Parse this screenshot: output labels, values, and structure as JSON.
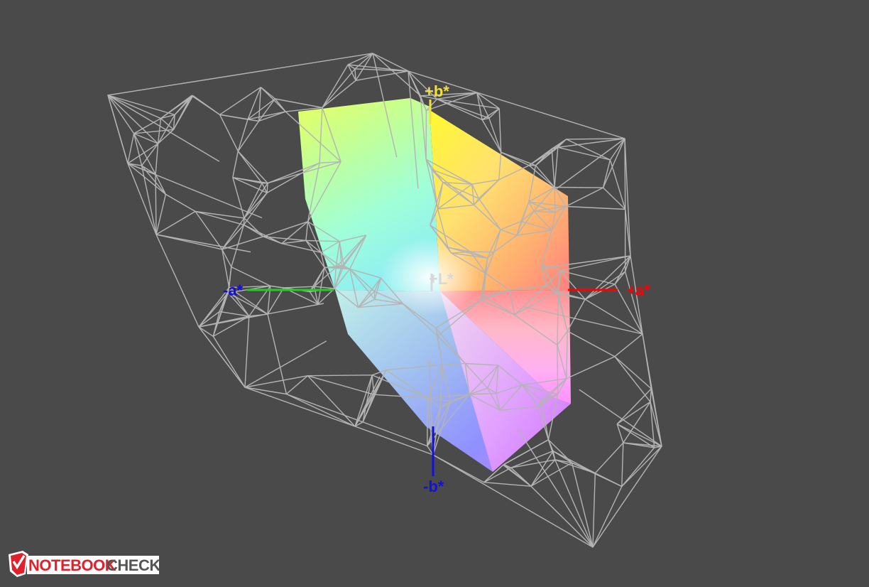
{
  "axes": {
    "plus_b": "+b*",
    "minus_a": "-a*",
    "plus_l": "+L*",
    "plus_a": "+a*",
    "minus_b": "-b*"
  },
  "colors": {
    "background": "#4a4a4a",
    "wireframe": "#b4b4b4",
    "axis_a_positive": "#ff0000",
    "axis_a_negative": "#22cc22",
    "axis_b_positive": "#f0e040",
    "axis_b_negative": "#1010e0",
    "axis_l": "#d8d8d8"
  },
  "logo": {
    "word1": "NOTEBOOK",
    "word2": "CHECK",
    "brand_color": "#e0202a",
    "icon": "checkmark-shield-icon"
  }
}
